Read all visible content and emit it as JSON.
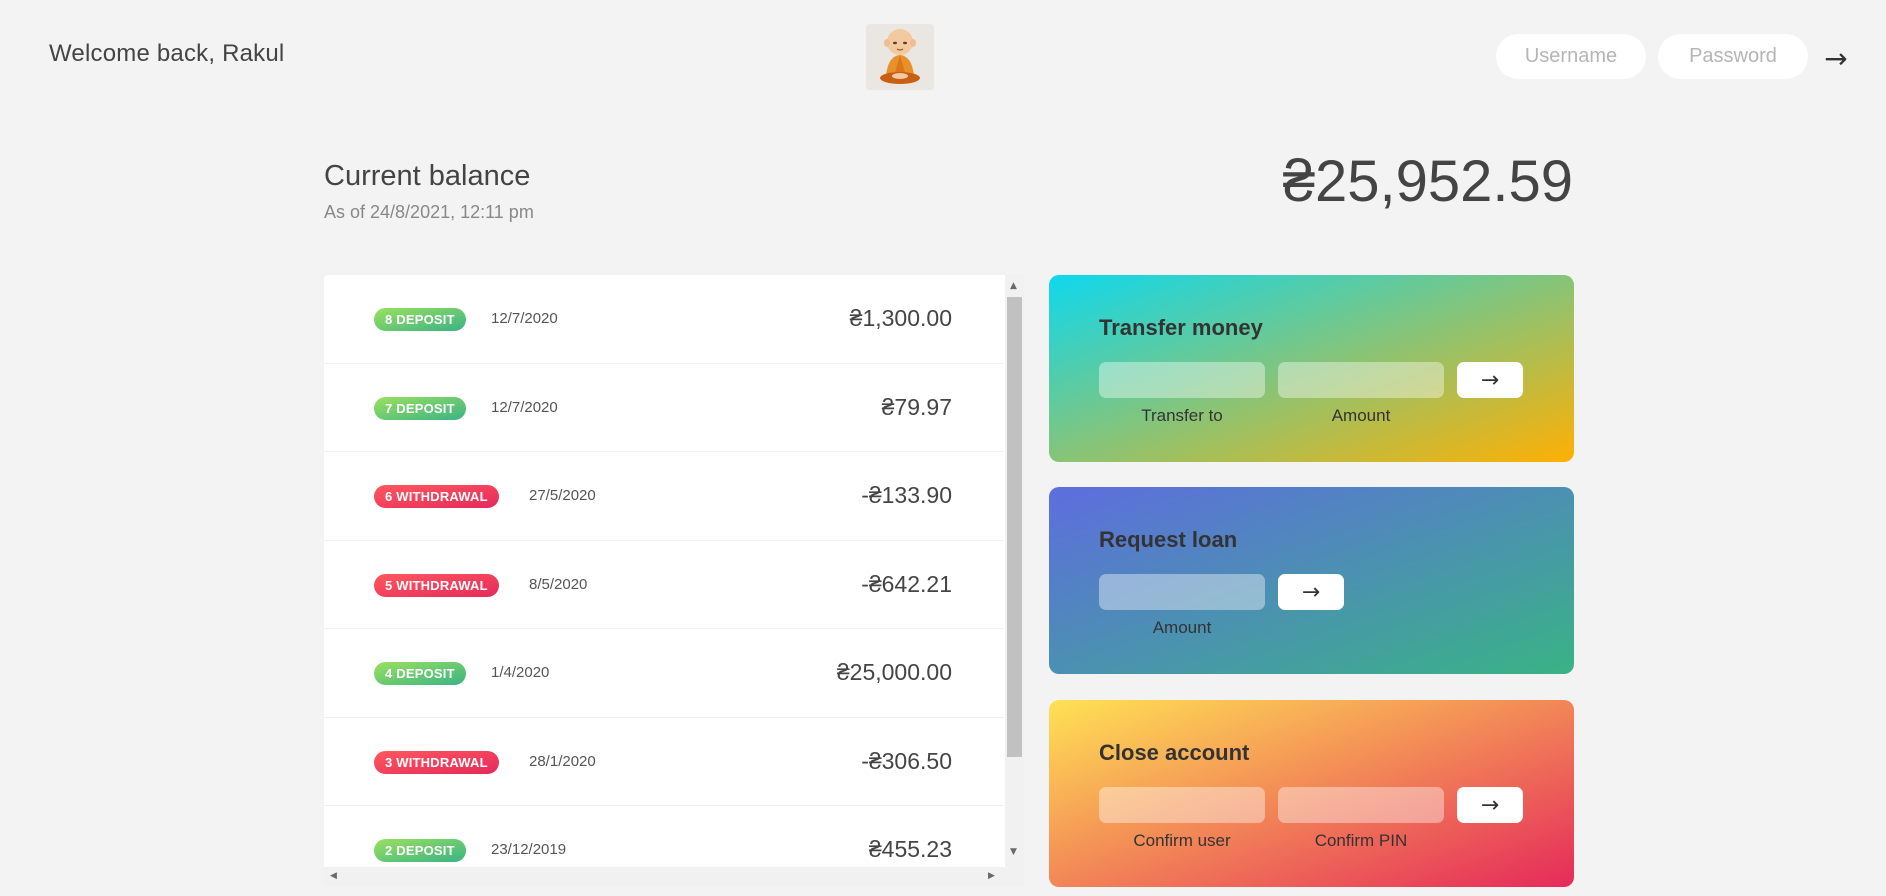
{
  "nav": {
    "welcome": "Welcome back, Rakul",
    "logo_icon": "monk-mascot-logo",
    "user_placeholder": "Username",
    "pin_placeholder": "Password",
    "login_arrow": "→"
  },
  "balance": {
    "label": "Current balance",
    "date": "As of 24/8/2021, 12:11 pm",
    "value": "₴25,952.59"
  },
  "movements": [
    {
      "type_label": "8 DEPOSIT",
      "kind": "deposit",
      "date": "12/7/2020",
      "value": "₴1,300.00"
    },
    {
      "type_label": "7 DEPOSIT",
      "kind": "deposit",
      "date": "12/7/2020",
      "value": "₴79.97"
    },
    {
      "type_label": "6 WITHDRAWAL",
      "kind": "withdrawal",
      "date": "27/5/2020",
      "value": "-₴133.90"
    },
    {
      "type_label": "5 WITHDRAWAL",
      "kind": "withdrawal",
      "date": "8/5/2020",
      "value": "-₴642.21"
    },
    {
      "type_label": "4 DEPOSIT",
      "kind": "deposit",
      "date": "1/4/2020",
      "value": "₴25,000.00"
    },
    {
      "type_label": "3 WITHDRAWAL",
      "kind": "withdrawal",
      "date": "28/1/2020",
      "value": "-₴306.50"
    },
    {
      "type_label": "2 DEPOSIT",
      "kind": "deposit",
      "date": "23/12/2019",
      "value": "₴455.23"
    }
  ],
  "operations": {
    "transfer": {
      "title": "Transfer money",
      "to_label": "Transfer to",
      "amount_label": "Amount",
      "button": "→"
    },
    "loan": {
      "title": "Request loan",
      "amount_label": "Amount",
      "button": "→"
    },
    "close": {
      "title": "Close account",
      "user_label": "Confirm user",
      "pin_label": "Confirm PIN",
      "button": "→"
    }
  },
  "colors": {
    "deposit": "#39b385",
    "withdrawal": "#e52a5a",
    "background": "#f3f3f3"
  }
}
